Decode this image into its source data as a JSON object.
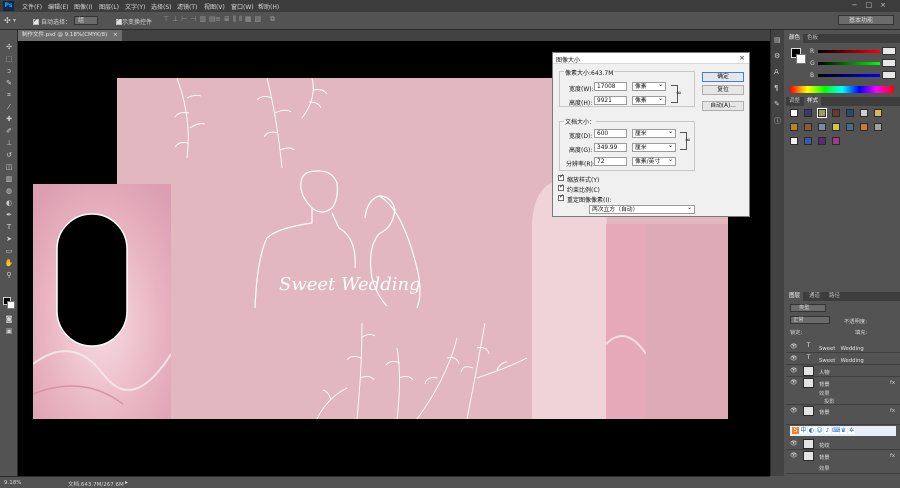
{
  "app": {
    "logo": "Ps",
    "menus": [
      "文件(F)",
      "编辑(E)",
      "图像(I)",
      "图层(L)",
      "文字(Y)",
      "选择(S)",
      "滤镜(T)",
      "视图(V)",
      "窗口(W)",
      "帮助(H)"
    ],
    "window_controls": [
      "−",
      "□",
      "×"
    ]
  },
  "options_bar": {
    "auto_select_label": "自动选择：",
    "auto_select_value": "组",
    "show_transform_label": "显示变换控件",
    "workspace": "基本功能"
  },
  "document": {
    "tab_title": "制作文件.psd @ 9.18%(CMYK/8)",
    "tab_close": "×"
  },
  "artwork": {
    "script_text": "Sweet Wedding"
  },
  "image_size_dialog": {
    "title": "图像大小",
    "close": "×",
    "pixel_dimensions": "像素大小:643.7M",
    "width_label": "宽度(W):",
    "width_value": "17008",
    "width_unit": "像素",
    "height_label": "高度(H):",
    "height_value": "9921",
    "height_unit": "像素",
    "doc_size_label": "文档大小：",
    "doc_width_label": "宽度(D):",
    "doc_width_value": "600",
    "doc_width_unit": "厘米",
    "doc_height_label": "高度(G):",
    "doc_height_value": "349.99",
    "doc_height_unit": "厘米",
    "resolution_label": "分辨率(R):",
    "resolution_value": "72",
    "resolution_unit": "像素/英寸",
    "scale_styles": "缩放样式(Y)",
    "constrain": "约束比例(C)",
    "resample": "重定图像像素(I):",
    "resample_method": "两次立方（自动）",
    "ok": "确定",
    "reset": "复位",
    "auto": "自动(A)..."
  },
  "panels": {
    "color_tabs": [
      "颜色",
      "色板"
    ],
    "color_channels": [
      "R",
      "G",
      "B"
    ],
    "color_values": [
      "",
      "",
      ""
    ],
    "style_tabs": [
      "调整",
      "样式"
    ],
    "layer_tabs": [
      "图层",
      "通道",
      "路径"
    ],
    "layer_kind": "类型",
    "blend_mode": "正常",
    "opacity_label": "不透明度:",
    "lock_label": "锁定:",
    "fill_label": "填充:",
    "layers": [
      {
        "type": "T",
        "name": "Sweet　Wedding",
        "fx": ""
      },
      {
        "type": "T",
        "name": "Sweet　Wedding",
        "fx": ""
      },
      {
        "type": "img",
        "name": "人物",
        "fx": ""
      },
      {
        "type": "img",
        "name": "背景",
        "fx": "fx"
      },
      {
        "type": "img",
        "name": "背景",
        "fx": "fx"
      },
      {
        "type": "img",
        "name": "花纹",
        "fx": ""
      },
      {
        "type": "img",
        "name": "背景",
        "fx": "fx"
      }
    ],
    "effects_label": "效果",
    "shadow_label": "投影",
    "ime_bar_label": "中"
  },
  "status": {
    "zoom": "9.18%",
    "doc_info": "文档:643.7M/267.6M"
  },
  "colors": {
    "accent_pink": "#e2b7bf",
    "workspace_bg": "#000000",
    "panel_bg": "#535353"
  }
}
